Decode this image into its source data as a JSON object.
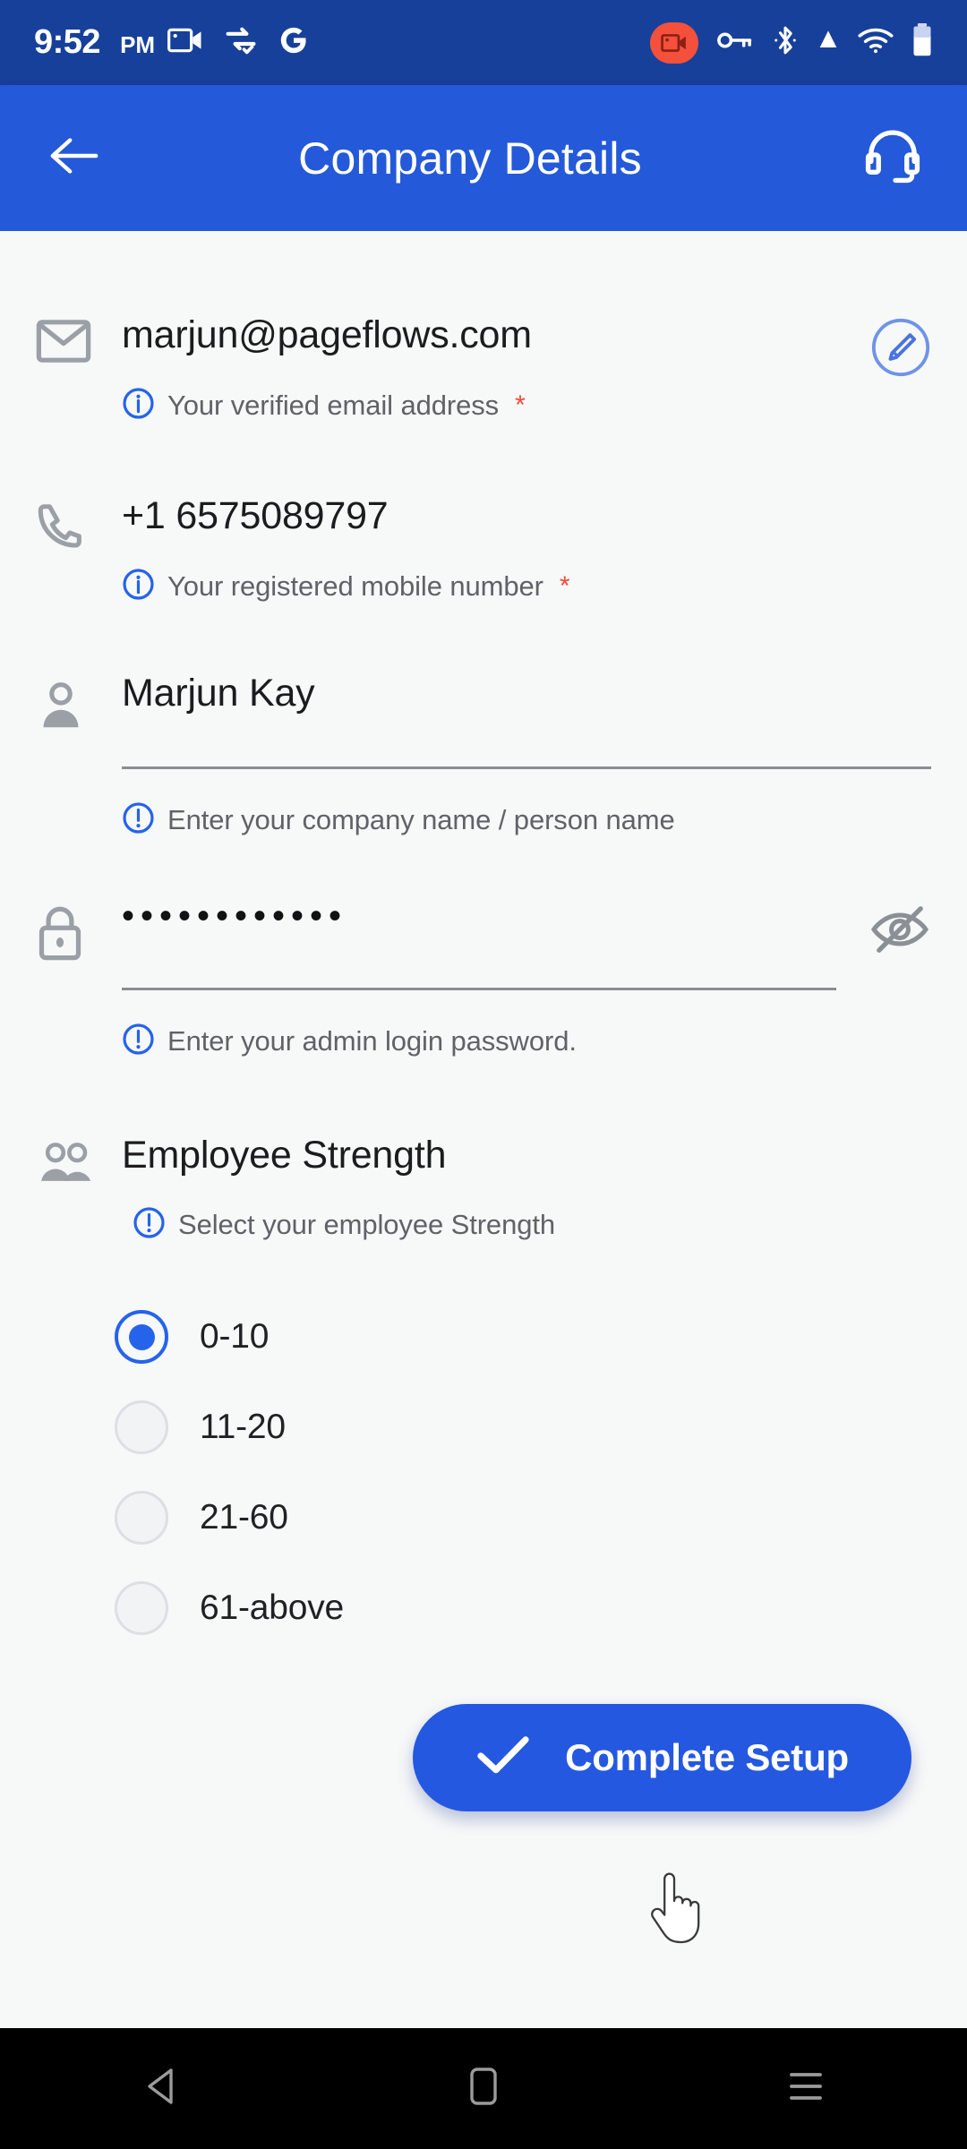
{
  "status_bar": {
    "time": "9:52",
    "ampm": "PM",
    "left_icons": [
      "screen-record-icon",
      "data-transfer-check-icon",
      "google-g-icon"
    ],
    "right_icons": [
      "screen-recording-active-badge",
      "vpn-key-icon",
      "bluetooth-icon",
      "signal-icon",
      "wifi-icon",
      "battery-icon"
    ],
    "bg_color": "#17409b"
  },
  "app_bar": {
    "title": "Company Details",
    "back_icon": "arrow-left-icon",
    "support_icon": "headset-icon",
    "bg_color": "#2459d9"
  },
  "form": {
    "email": {
      "icon": "envelope-icon",
      "value": "marjun@pageflows.com",
      "hint_icon": "info-circle-icon",
      "hint": "Your verified email address",
      "required": "*",
      "edit_icon": "pencil-edit-icon"
    },
    "phone": {
      "icon": "phone-icon",
      "value": "+1 6575089797",
      "hint_icon": "info-circle-icon",
      "hint": "Your registered mobile number",
      "required": "*"
    },
    "name": {
      "icon": "person-icon",
      "value": "Marjun Kay",
      "placeholder": "Enter your company name / person name",
      "hint_icon": "exclamation-circle-icon",
      "hint": "Enter your company name / person name"
    },
    "password": {
      "icon": "lock-icon",
      "value": "••••••••••••",
      "masked_length": 12,
      "hint_icon": "exclamation-circle-icon",
      "hint": "Enter your admin login password.",
      "visibility_icon": "eye-off-icon",
      "visible": false
    },
    "employee_strength": {
      "icon": "people-group-icon",
      "label": "Employee Strength",
      "hint_icon": "exclamation-circle-icon",
      "hint": "Select your employee Strength",
      "selected": "0-10",
      "options": [
        {
          "label": "0-10",
          "selected": true
        },
        {
          "label": "11-20",
          "selected": false
        },
        {
          "label": "21-60",
          "selected": false
        },
        {
          "label": "61-above",
          "selected": false
        }
      ]
    }
  },
  "cta": {
    "label": "Complete Setup",
    "icon": "check-icon",
    "bg_color": "#2558e0"
  },
  "nav_bar": {
    "back_icon": "nav-back-triangle-icon",
    "home_icon": "nav-home-square-icon",
    "recents_icon": "nav-recents-lines-icon",
    "bg_color": "#000000"
  },
  "colors": {
    "accent": "#2563eb",
    "page_bg": "#f7f8f8",
    "hint_text": "#5f6368",
    "value_text": "#1c1c1e",
    "required_star": "#ef4b3c"
  }
}
